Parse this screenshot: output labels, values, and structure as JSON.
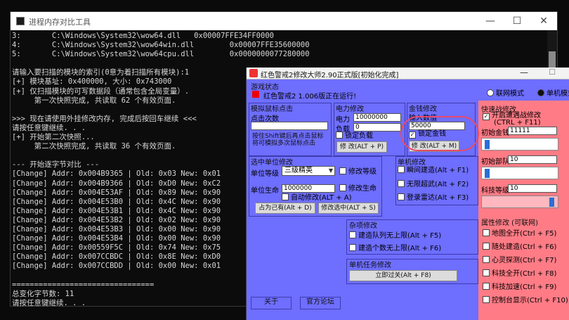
{
  "console": {
    "title": "进程内存对比工具",
    "lines": [
      "3:       C:\\Windows\\System32\\wow64.dll   0x00007FFE34FF0000",
      "4:       C:\\Windows\\System32\\wow64win.dll        0x00007FFE35600000",
      "5:       C:\\Windows\\System32\\wow64cpu.dll        0x0000000077280000",
      "",
      "请输入要扫描的模块的索引(0意为着扫描所有模块):1",
      "[+] 模块基址: 0x400000, 大小: 0x743000",
      "[+] 仅扫描模块的可写数据段（通常包含全局变量）.",
      "     第一次快照完成, 共读取 62 个有效页面.",
      "",
      ">>> 现在请使用外挂修改内存, 完成后按回车继续 <<<",
      "请按任意键继续. . .",
      "[+] 开始第二次快照...",
      "     第二次快照完成, 共读取 36 个有效页面.",
      "",
      "--- 开始逐字节对比 ---",
      "[Change] Addr: 0x004B9365 | Old: 0x03 New: 0x01",
      "[Change] Addr: 0x004B9366 | Old: 0xD0 New: 0xC2",
      "[Change] Addr: 0x004E53AF | Old: 0x89 New: 0x90",
      "[Change] Addr: 0x004E53B0 | Old: 0x4C New: 0x90",
      "[Change] Addr: 0x004E53B1 | Old: 0x4C New: 0x90",
      "[Change] Addr: 0x004E53B2 | Old: 0x02 New: 0x90",
      "[Change] Addr: 0x004E53B3 | Old: 0x00 New: 0x90",
      "[Change] Addr: 0x004E53B4 | Old: 0x00 New: 0x90",
      "[Change] Addr: 0x00559F5C | Old: 0x74 New: 0x75",
      "[Change] Addr: 0x007CCBDC | Old: 0x8E New: 0xD0",
      "[Change] Addr: 0x007CCBDD | Old: 0x00 New: 0x01",
      "",
      "================================",
      "总变化字节数: 11",
      "请按任意键继续. . ."
    ]
  },
  "trainer": {
    "title": "红色警戒2修改大师2.90正式版[初始化完成]",
    "status_group": "游戏状态",
    "status_text": "红色警戒2 1.006版正在运行!",
    "mode_online": "联网模式",
    "mode_single": "单机模式",
    "mouse_group": "模拟鼠标点击",
    "click_count_label": "点击次数",
    "shift_hint": "按住Shift键后再点击鼠标将可模拟多次鼠标点击",
    "power_group": "电力修改",
    "power_label": "电力",
    "power_value": "10000000",
    "load_label": "负载",
    "load_value": "0",
    "lock_load": "锁定负载",
    "power_btn": "修 改(ALT + P)",
    "money_group": "金钱修改",
    "money_input_label": "输入数值",
    "money_value": "50000",
    "lock_money": "锁定金钱",
    "money_btn": "修 改(ALT + M)",
    "quick_group": "快速战修改",
    "enable_quick": "开启遭遇战修改",
    "quick_hotkey": "(CTRL + F11)",
    "init_money_label": "初始金钱",
    "init_money_value": "11111",
    "init_units_label": "初始部队",
    "init_units_value": "10",
    "tech_level_label": "科技等级",
    "tech_level_value": "10",
    "unit_group": "选中单位修改",
    "unit_level_label": "单位等级",
    "unit_level_value": "三级精英",
    "modify_level": "修改等级",
    "unit_life_label": "单位生命",
    "unit_life_value": "1000000",
    "modify_life": "修改生命",
    "auto_modify": "自动修改(ALT + A)",
    "occupy_btn": "占为己有(Alt + D)",
    "modify_selected_btn": "修改选中(ALT + S)",
    "single_group": "单机修改",
    "instant_build": "瞬间建造(Alt + F1)",
    "unlimited_power": "无限超武(Alt + F2)",
    "radar": "登录雷达(Alt + F3)",
    "misc_group": "杂项修改",
    "build_queue": "建造队列无上限(Alt + F5)",
    "build_count": "建造个数无上限(Alt + F6)",
    "mission_group": "单机任务修改",
    "pass_btn": "立即过关(Alt + F8)",
    "attr_group": "属性修改 (可联网)",
    "attr_items": [
      "地图全开(Ctrl + F5)",
      "随处建造(Ctrl + F6)",
      "心灵探测(Ctrl + F7)",
      "科技全开(Ctrl + F8)",
      "科技加速(Ctrl + F9)",
      "控制台显示(Ctrl + F10)"
    ],
    "about_btn": "关于",
    "forum_btn": "官方论坛"
  },
  "colors": {
    "trainer_bg": "#6e6eff",
    "pink_panel": "#ff7c86",
    "highlight_circle": "#e84a68"
  }
}
